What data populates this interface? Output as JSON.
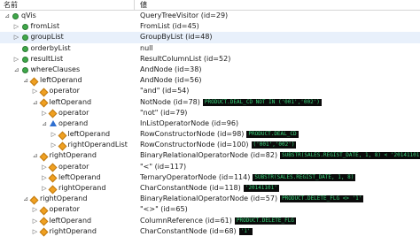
{
  "header": {
    "name_col": "名前",
    "value_col": "値"
  },
  "colors": {
    "badge_bg": "#0b0b0b",
    "badge_fg": "#39d47a",
    "selection": "#e8f0fb"
  },
  "rows": [
    {
      "depth": 0,
      "toggle": "⊿",
      "icon": "green-dot-icon",
      "name": "qVis",
      "value": "QueryTreeVisitor  (id=29)",
      "badge": ""
    },
    {
      "depth": 1,
      "toggle": "▷",
      "icon": "green-dot-icon",
      "name": "fromList",
      "value": "FromList  (id=45)",
      "badge": ""
    },
    {
      "depth": 1,
      "toggle": "▷",
      "icon": "green-dot-icon",
      "name": "groupList",
      "value": "GroupByList  (id=48)",
      "badge": "",
      "selected": true
    },
    {
      "depth": 1,
      "toggle": "",
      "icon": "green-dot-icon",
      "name": "orderbyList",
      "value": "null",
      "badge": ""
    },
    {
      "depth": 1,
      "toggle": "▷",
      "icon": "green-dot-icon",
      "name": "resultList",
      "value": "ResultColumnList  (id=52)",
      "badge": ""
    },
    {
      "depth": 1,
      "toggle": "⊿",
      "icon": "green-dot-icon",
      "name": "whereClauses",
      "value": "AndNode  (id=38)",
      "badge": ""
    },
    {
      "depth": 2,
      "toggle": "⊿",
      "icon": "orange-diamond-icon",
      "name": "leftOperand",
      "value": "AndNode  (id=56)",
      "badge": ""
    },
    {
      "depth": 3,
      "toggle": "▷",
      "icon": "orange-diamond-icon",
      "name": "operator",
      "value": "\"and\"  (id=54)",
      "badge": ""
    },
    {
      "depth": 3,
      "toggle": "⊿",
      "icon": "orange-diamond-icon",
      "name": "leftOperand",
      "value": "NotNode  (id=78)",
      "badge": "PRODUCT.DEAL_CD NOT IN ('001','002')"
    },
    {
      "depth": 4,
      "toggle": "▷",
      "icon": "orange-diamond-icon",
      "name": "operator",
      "value": "\"not\"  (id=79)",
      "badge": ""
    },
    {
      "depth": 4,
      "toggle": "⊿",
      "icon": "blue-triangle-icon",
      "name": "operand",
      "value": "InListOperatorNode  (id=96)",
      "badge": ""
    },
    {
      "depth": 5,
      "toggle": "▷",
      "icon": "orange-diamond-icon",
      "name": "leftOperand",
      "value": "RowConstructorNode  (id=98)",
      "badge": "PRODUCT.DEAL_CD"
    },
    {
      "depth": 5,
      "toggle": "▷",
      "icon": "orange-diamond-icon",
      "name": "rightOperandList",
      "value": "RowConstructorNode  (id=100)",
      "badge": "('001','002')"
    },
    {
      "depth": 3,
      "toggle": "⊿",
      "icon": "orange-diamond-icon",
      "name": "rightOperand",
      "value": "BinaryRelationalOperatorNode  (id=82)",
      "badge": "SUBSTR(SALES.REGIST_DATE, 1, 8) < '20141101'"
    },
    {
      "depth": 4,
      "toggle": "▷",
      "icon": "orange-diamond-icon",
      "name": "operator",
      "value": "\"<\"  (id=117)",
      "badge": ""
    },
    {
      "depth": 4,
      "toggle": "▷",
      "icon": "orange-diamond-icon",
      "name": "leftOperand",
      "value": "TernaryOperatorNode  (id=114)",
      "badge": "SUBSTR(SALES.REGIST_DATE, 1, 8)"
    },
    {
      "depth": 4,
      "toggle": "▷",
      "icon": "orange-diamond-icon",
      "name": "rightOperand",
      "value": "CharConstantNode  (id=118)",
      "badge": "'20141101'"
    },
    {
      "depth": 2,
      "toggle": "⊿",
      "icon": "orange-diamond-icon",
      "name": "rightOperand",
      "value": "BinaryRelationalOperatorNode  (id=57)",
      "badge": "PRODUCT.DELETE_FLG <> '1'"
    },
    {
      "depth": 3,
      "toggle": "▷",
      "icon": "orange-diamond-icon",
      "name": "operator",
      "value": "\"<>\"  (id=65)",
      "badge": ""
    },
    {
      "depth": 3,
      "toggle": "▷",
      "icon": "orange-diamond-icon",
      "name": "leftOperand",
      "value": "ColumnReference  (id=61)",
      "badge": "PRODUCT.DELETE_FLG"
    },
    {
      "depth": 3,
      "toggle": "▷",
      "icon": "orange-diamond-icon",
      "name": "rightOperand",
      "value": "CharConstantNode  (id=68)",
      "badge": "'1'"
    }
  ]
}
